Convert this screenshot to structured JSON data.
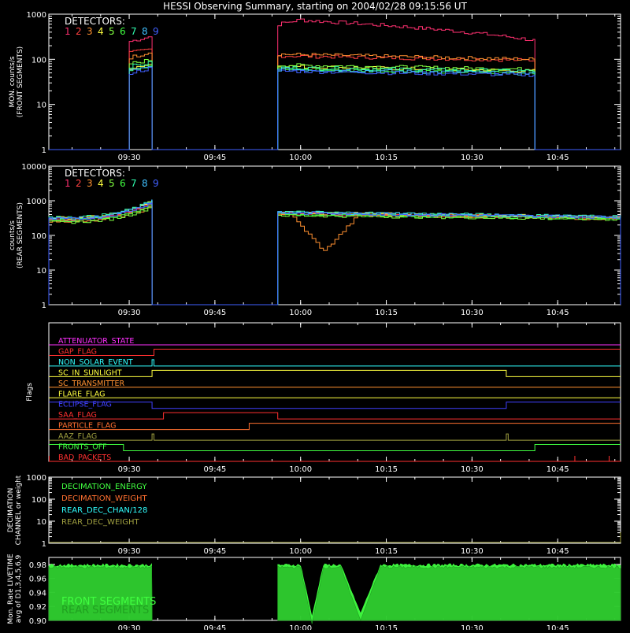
{
  "title": "HESSI Observing Summary, starting on 2004/02/28 09:15:56 UT",
  "time_ticks": [
    "09:30",
    "09:45",
    "10:00",
    "10:15",
    "10:30",
    "10:45"
  ],
  "detector_colors": [
    "#ff3070",
    "#ff4040",
    "#ff9030",
    "#ffff40",
    "#80ff40",
    "#40ff40",
    "#30ffb0",
    "#40c0ff",
    "#4060ff"
  ],
  "chart_data": [
    {
      "type": "line",
      "panel": "front",
      "ylabel": "MON. counts/s (FRONT SEGMENTS)",
      "ylabel_lines": [
        "MON. counts/s",
        "(FRONT SEGMENTS)"
      ],
      "y_scale": "log",
      "ylim": [
        1,
        1000
      ],
      "y_ticks": [
        "1",
        "10",
        "100",
        "1000"
      ],
      "legend_title": "DETECTORS:",
      "legend_numbers": [
        "1",
        "2",
        "3",
        "4",
        "5",
        "6",
        "7",
        "8",
        "9"
      ],
      "series_profile": [
        {
          "name": "1",
          "pre": [
            250,
            330
          ],
          "main": [
            780,
            260
          ]
        },
        {
          "name": "2",
          "pre": [
            140,
            170
          ],
          "main": [
            120,
            95
          ]
        },
        {
          "name": "3",
          "pre": [
            110,
            150
          ],
          "main": [
            130,
            100
          ]
        },
        {
          "name": "4",
          "pre": [
            65,
            80
          ],
          "main": [
            70,
            55
          ]
        },
        {
          "name": "5",
          "pre": [
            80,
            100
          ],
          "main": [
            75,
            60
          ]
        },
        {
          "name": "6",
          "pre": [
            60,
            75
          ],
          "main": [
            60,
            50
          ]
        },
        {
          "name": "7",
          "pre": [
            70,
            85
          ],
          "main": [
            65,
            55
          ]
        },
        {
          "name": "8",
          "pre": [
            55,
            70
          ],
          "main": [
            60,
            48
          ]
        },
        {
          "name": "9",
          "pre": [
            50,
            65
          ],
          "main": [
            55,
            45
          ]
        }
      ],
      "intervals": [
        [
          "09:30",
          "09:34"
        ],
        [
          "09:56",
          "10:41"
        ]
      ]
    },
    {
      "type": "line",
      "panel": "rear",
      "ylabel": "counts/s (REAR SEGMENTS)",
      "ylabel_lines": [
        "counts/s",
        "(REAR SEGMENTS)"
      ],
      "y_scale": "log",
      "ylim": [
        1,
        10000
      ],
      "y_ticks": [
        "1",
        "10",
        "100",
        "1000",
        "10000"
      ],
      "legend_title": "DETECTORS:",
      "legend_numbers": [
        "1",
        "2",
        "3",
        "4",
        "5",
        "6",
        "7",
        "8",
        "9"
      ],
      "series_profile": [
        {
          "name": "1",
          "pre": [
            280,
            900
          ],
          "main": [
            420,
            320
          ]
        },
        {
          "name": "2",
          "pre": [
            300,
            950
          ],
          "main": [
            440,
            330
          ]
        },
        {
          "name": "3",
          "pre": [
            260,
            700
          ],
          "main": [
            420,
            300
          ],
          "dip": [
            35,
            "10:04"
          ]
        },
        {
          "name": "4",
          "pre": [
            320,
            1000
          ],
          "main": [
            460,
            340
          ]
        },
        {
          "name": "5",
          "pre": [
            240,
            700
          ],
          "main": [
            380,
            290
          ]
        },
        {
          "name": "6",
          "pre": [
            270,
            800
          ],
          "main": [
            400,
            310
          ]
        },
        {
          "name": "7",
          "pre": [
            330,
            1050
          ],
          "main": [
            480,
            350
          ]
        },
        {
          "name": "8",
          "pre": [
            310,
            1000
          ],
          "main": [
            460,
            345
          ]
        },
        {
          "name": "9",
          "pre": [
            300,
            950
          ],
          "main": [
            450,
            335
          ]
        }
      ],
      "intervals": [
        [
          "09:15:56",
          "09:34"
        ],
        [
          "09:56",
          "10:56"
        ]
      ]
    },
    {
      "type": "flags",
      "ylabel": "Flags",
      "flags": [
        {
          "name": "ATTENUATOR_STATE",
          "color": "#ff30ff",
          "transitions": []
        },
        {
          "name": "GAP_FLAG",
          "color": "#ff3030",
          "transitions": [
            "09:34:20"
          ]
        },
        {
          "name": "NON_SOLAR_EVENT",
          "color": "#30ffff",
          "transitions": [
            "09:34",
            "09:34:20"
          ],
          "mode": "pulse"
        },
        {
          "name": "SC_IN_SUNLIGHT",
          "color": "#ffff40",
          "transitions": [
            "09:34",
            "10:36"
          ]
        },
        {
          "name": "SC_TRANSMITTER",
          "color": "#ff9030",
          "transitions": []
        },
        {
          "name": "FLARE_FLAG",
          "color": "#ffff40",
          "transitions": []
        },
        {
          "name": "ECLIPSE_FLAG",
          "color": "#4040ff",
          "transitions": [
            "09:34",
            "10:36"
          ],
          "invert": true
        },
        {
          "name": "SAA_FLAG",
          "color": "#ff3030",
          "transitions": [
            "09:36",
            "09:56"
          ]
        },
        {
          "name": "PARTICLE_FLAG",
          "color": "#ff7030",
          "transitions": [
            "09:51"
          ],
          "label_display": "PARTICLE_FLAG"
        },
        {
          "name": "AAZ_FLAG",
          "color": "#a0a040",
          "transitions": [
            "09:34",
            "09:34:20",
            "10:36",
            "10:36:20"
          ],
          "mode": "pulse"
        },
        {
          "name": "FRONTS_OFF",
          "color": "#40ff40",
          "transitions": [
            "09:29",
            "10:41"
          ],
          "invert": true
        },
        {
          "name": "BAD_PACKETS",
          "color": "#ff3030",
          "transitions": [],
          "spikes": [
            "09:16",
            "10:48",
            "10:54"
          ]
        }
      ]
    },
    {
      "type": "line",
      "panel": "decimation",
      "ylabel": "DECIMATION CHANNEL or weight",
      "ylabel_lines": [
        "DECIMATION",
        "CHANNEL or weight"
      ],
      "y_scale": "log",
      "ylim": [
        1,
        1000
      ],
      "y_ticks": [
        "1",
        "10",
        "100",
        "1000"
      ],
      "legend": [
        {
          "name": "DECIMATION_ENERGY",
          "color": "#40ff40"
        },
        {
          "name": "DECIMATION_WEIGHT",
          "color": "#ff7030"
        },
        {
          "name": "REAR_DEC_CHAN/128",
          "color": "#30ffff"
        },
        {
          "name": "REAR_DEC_WEIGHT",
          "color": "#a0a040"
        }
      ],
      "spike_at": "10:56"
    },
    {
      "type": "area",
      "panel": "livetime",
      "ylabel": "Mon. Rate LIVETIME avg of D1,3,4,5,6,9",
      "ylabel_lines": [
        "Mon. Rate LIVETIME",
        "avg of D1,3,4,5,6,9"
      ],
      "ylim": [
        0.9,
        0.99
      ],
      "y_ticks": [
        "0.90",
        "0.92",
        "0.94",
        "0.96",
        "0.98"
      ],
      "series": [
        {
          "name": "FRONT SEGMENTS",
          "color": "#40ff40",
          "level": 0.979
        },
        {
          "name": "REAR SEGMENTS",
          "color": "#20a020",
          "level": 0.976
        }
      ],
      "intervals": [
        [
          "09:15:56",
          "09:34"
        ],
        [
          "09:56",
          "10:56"
        ]
      ],
      "dips": [
        [
          "10:00",
          "10:04",
          0.895
        ],
        [
          "10:07",
          "10:14",
          0.9
        ]
      ]
    }
  ]
}
